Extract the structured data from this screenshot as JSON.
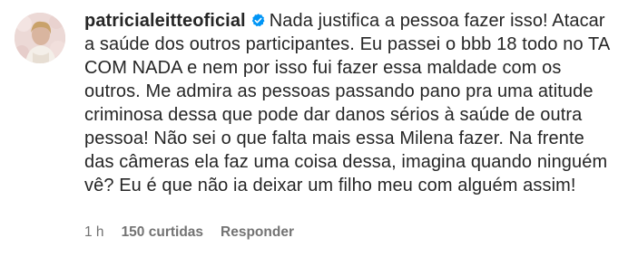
{
  "comment": {
    "username": "patricialeitteoficial",
    "verified": true,
    "text": "Nada justifica a pessoa fazer isso! Atacar a saúde dos outros participantes. Eu passei o bbb 18 todo no TA COM NADA e nem por isso fui fazer essa maldade com os outros. Me admira as pessoas passando pano pra uma atitude criminosa dessa que pode dar danos sérios à saúde de outra pessoa! Não sei o que falta mais essa Milena fazer. Na frente das câmeras ela faz uma coisa dessa, imagina quando ninguém vê? Eu é que não ia deixar um filho meu com alguém assim!",
    "timestamp": "1 h",
    "likes": "150 curtidas",
    "reply_label": "Responder"
  },
  "colors": {
    "text": "#262626",
    "muted": "#737373",
    "verified_badge": "#0095f6"
  }
}
